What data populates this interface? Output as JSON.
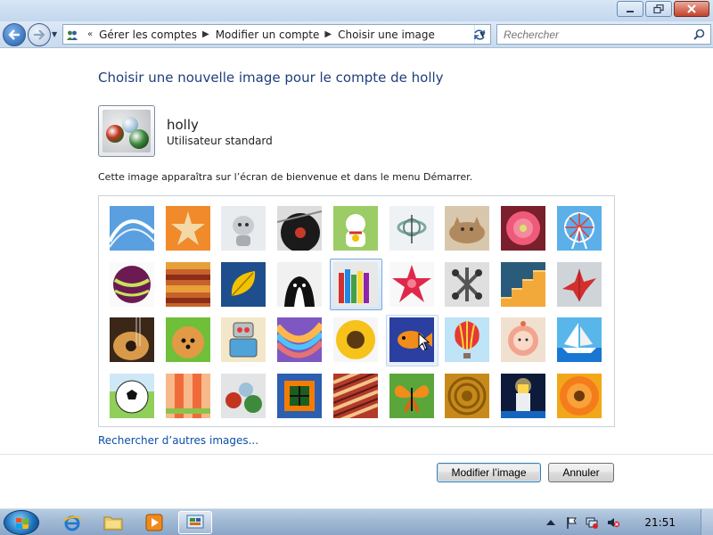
{
  "window": {
    "caption_buttons": [
      "minimize",
      "maximize",
      "close"
    ]
  },
  "address_bar": {
    "breadcrumb": [
      "Gérer les comptes",
      "Modifier un compte",
      "Choisir une image"
    ],
    "search_placeholder": "Rechercher"
  },
  "page": {
    "title": "Choisir une nouvelle image pour le compte de holly",
    "user_name": "holly",
    "user_type": "Utilisateur standard",
    "description": "Cette image apparaîtra sur l’écran de bienvenue et dans le menu Démarrer.",
    "more_images_link": "Rechercher d’autres images...",
    "selected_image": "crayons",
    "hovered_image": "fish"
  },
  "pictures": [
    "roller-coaster",
    "starfish",
    "robot-dog",
    "vinyl-record",
    "lucky-cat",
    "gyroscope",
    "kitten",
    "pink-flower",
    "ferris-wheel",
    "ball",
    "fabric",
    "leaf",
    "dog",
    "crayons",
    "red-star",
    "jacks",
    "stairs",
    "origami-crane",
    "guitar",
    "pomeranian",
    "toy-robot",
    "hammock",
    "sunflower",
    "fish",
    "hot-air-balloon",
    "doll",
    "sailboat",
    "soccer-ball",
    "textile",
    "marbles",
    "window",
    "rug",
    "butterfly",
    "sunflower-center",
    "lighthouse",
    "gerbera"
  ],
  "buttons": {
    "ok": "Modifier l’image",
    "cancel": "Annuler"
  },
  "taskbar": {
    "apps": [
      "internet-explorer",
      "windows-explorer",
      "media-player",
      "control-panel"
    ],
    "tray": [
      "show-hidden-icons",
      "action-center",
      "network",
      "volume-muted"
    ],
    "clock": "21:51"
  }
}
